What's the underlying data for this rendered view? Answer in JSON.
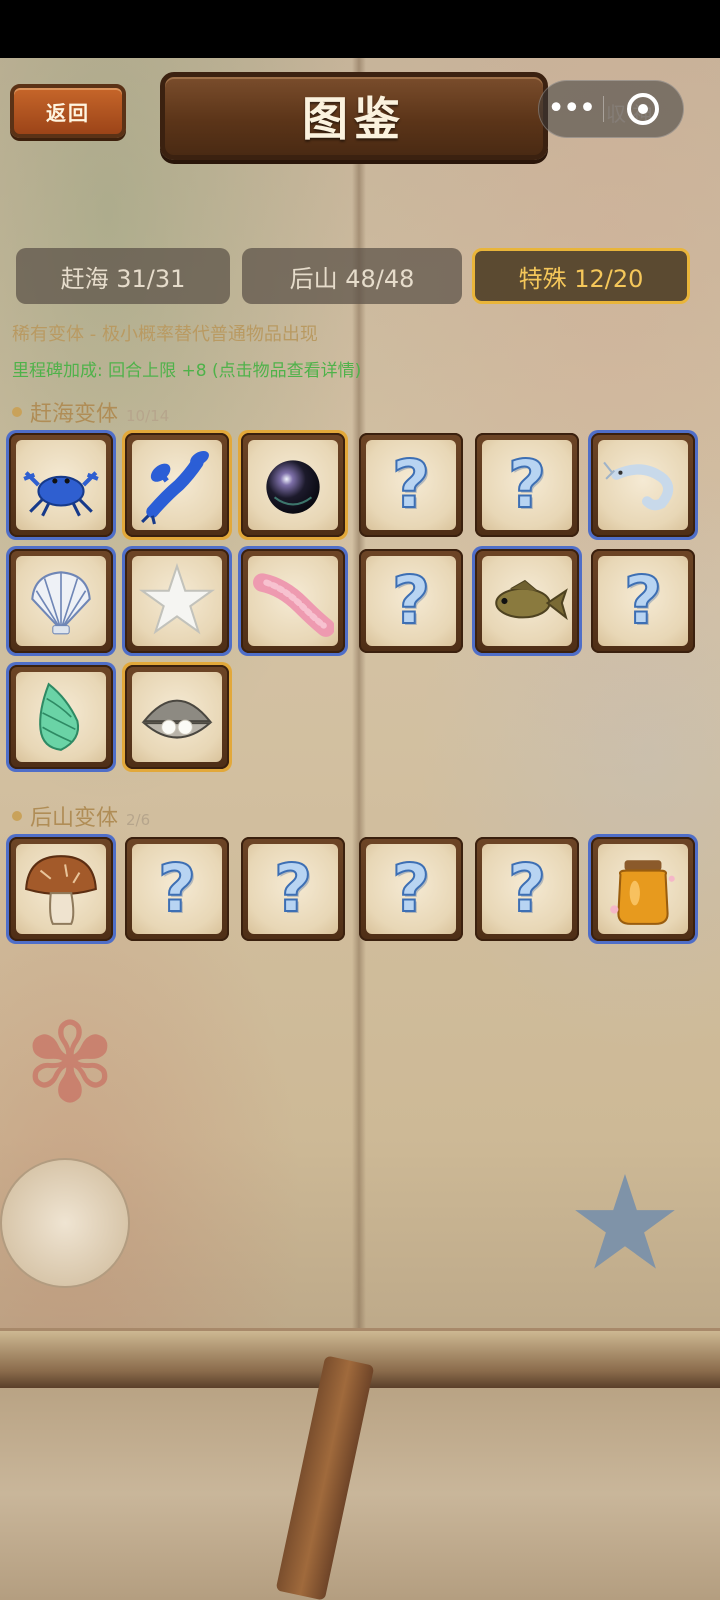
{
  "header": {
    "back_label": "返回",
    "title": "图鉴",
    "capsule_more": "•••",
    "capsule_ghost": "収 神"
  },
  "tabs": [
    {
      "label": "赶海 31/31",
      "active": false
    },
    {
      "label": "后山 48/48",
      "active": false
    },
    {
      "label": "特殊 12/20",
      "active": true
    }
  ],
  "info": {
    "line1": "稀有变体 - 极小概率替代普通物品出现",
    "line2": "里程碑加成: 回合上限 +8 (点击物品查看详情)"
  },
  "sections": [
    {
      "name": "赶海变体",
      "count": "10/14",
      "items": [
        {
          "icon": "blue-crab-icon",
          "found": true,
          "border": "rare"
        },
        {
          "icon": "blue-lobster-icon",
          "found": true,
          "border": "gold"
        },
        {
          "icon": "black-pearl-icon",
          "found": true,
          "border": "gold"
        },
        {
          "icon": "question-mark-icon",
          "found": false,
          "border": "none"
        },
        {
          "icon": "question-mark-icon",
          "found": false,
          "border": "none"
        },
        {
          "icon": "white-shrimp-icon",
          "found": true,
          "border": "rare"
        },
        {
          "icon": "scallop-shell-icon",
          "found": true,
          "border": "rare"
        },
        {
          "icon": "white-starfish-icon",
          "found": true,
          "border": "rare"
        },
        {
          "icon": "pink-sea-cucumber-icon",
          "found": true,
          "border": "rare"
        },
        {
          "icon": "question-mark-icon",
          "found": false,
          "border": "none"
        },
        {
          "icon": "fish-icon",
          "found": true,
          "border": "rare"
        },
        {
          "icon": "question-mark-icon",
          "found": false,
          "border": "none"
        },
        {
          "icon": "green-conch-icon",
          "found": true,
          "border": "rare"
        },
        {
          "icon": "pearl-clam-icon",
          "found": true,
          "border": "gold"
        }
      ]
    },
    {
      "name": "后山变体",
      "count": "2/6",
      "items": [
        {
          "icon": "mushroom-icon",
          "found": true,
          "border": "rare"
        },
        {
          "icon": "question-mark-icon",
          "found": false,
          "border": "none"
        },
        {
          "icon": "question-mark-icon",
          "found": false,
          "border": "none"
        },
        {
          "icon": "question-mark-icon",
          "found": false,
          "border": "none"
        },
        {
          "icon": "question-mark-icon",
          "found": false,
          "border": "none"
        },
        {
          "icon": "honey-jar-icon",
          "found": true,
          "border": "rare"
        }
      ]
    }
  ],
  "question_glyph": "?",
  "colors": {
    "rare_border": "#4f6ec8",
    "gold_border": "#e2a83a",
    "active_tab": "#f5c75a",
    "milestone_text": "#4fb24a"
  }
}
